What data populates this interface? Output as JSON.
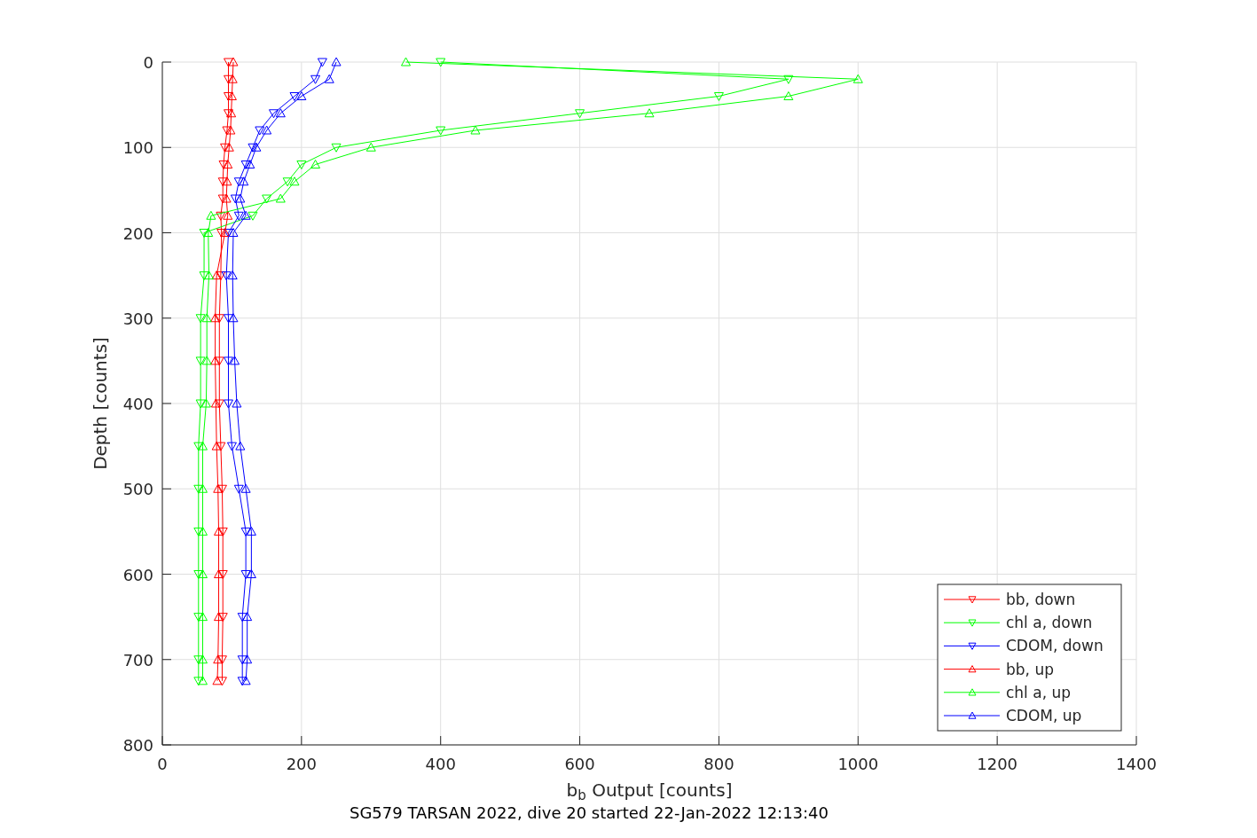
{
  "chart_data": {
    "type": "line",
    "orientation": "horizontal",
    "grid": true,
    "legend": "lower right",
    "xlabel": "b$_{b}$ Output [counts]",
    "ylabel": "Depth [counts]",
    "x": [
      0,
      20,
      40,
      60,
      80,
      100,
      120,
      140,
      160,
      180,
      200,
      250,
      300,
      350,
      400,
      450,
      500,
      550,
      600,
      650,
      700,
      725
    ],
    "xlim": [
      0,
      1400
    ],
    "ylim": [
      800,
      0
    ],
    "xticks": [
      0,
      200,
      400,
      600,
      800,
      1000,
      1200,
      1400
    ],
    "yticks": [
      0,
      100,
      200,
      300,
      400,
      500,
      600,
      700,
      800
    ],
    "series": [
      {
        "name": "bb, down",
        "color": "#ff0000",
        "marker": "triangle_down",
        "values": [
          95,
          95,
          95,
          95,
          93,
          90,
          88,
          87,
          87,
          84,
          85,
          84,
          82,
          82,
          82,
          84,
          86,
          87,
          87,
          87,
          86,
          86
        ]
      },
      {
        "name": "chl a, down",
        "color": "#00ff00",
        "marker": "triangle_down",
        "values": [
          400,
          900,
          800,
          600,
          400,
          250,
          200,
          180,
          150,
          130,
          60,
          60,
          55,
          55,
          55,
          52,
          52,
          52,
          52,
          52,
          52,
          52
        ]
      },
      {
        "name": "CDOM, down",
        "color": "#0000ff",
        "marker": "triangle_down",
        "values": [
          230,
          220,
          190,
          160,
          140,
          130,
          120,
          110,
          105,
          110,
          95,
          92,
          95,
          95,
          95,
          100,
          110,
          120,
          120,
          115,
          115,
          115
        ]
      },
      {
        "name": "bb, up",
        "color": "#ff0000",
        "marker": "triangle",
        "values": [
          102,
          101,
          100,
          99,
          98,
          96,
          94,
          93,
          92,
          94,
          90,
          78,
          76,
          76,
          77,
          78,
          80,
          81,
          81,
          81,
          80,
          79
        ]
      },
      {
        "name": "chl a, up",
        "color": "#00ff00",
        "marker": "triangle",
        "values": [
          350,
          1000,
          900,
          700,
          450,
          300,
          220,
          190,
          170,
          70,
          66,
          67,
          64,
          64,
          63,
          58,
          58,
          58,
          58,
          58,
          58,
          58
        ]
      },
      {
        "name": "CDOM, up",
        "color": "#0000ff",
        "marker": "triangle",
        "values": [
          250,
          240,
          200,
          170,
          150,
          135,
          126,
          117,
          112,
          120,
          102,
          101,
          102,
          104,
          107,
          112,
          120,
          128,
          128,
          122,
          122,
          120
        ]
      }
    ]
  },
  "caption": "SG579 TARSAN 2022, dive 20 started 22-Jan-2022 12:13:40"
}
